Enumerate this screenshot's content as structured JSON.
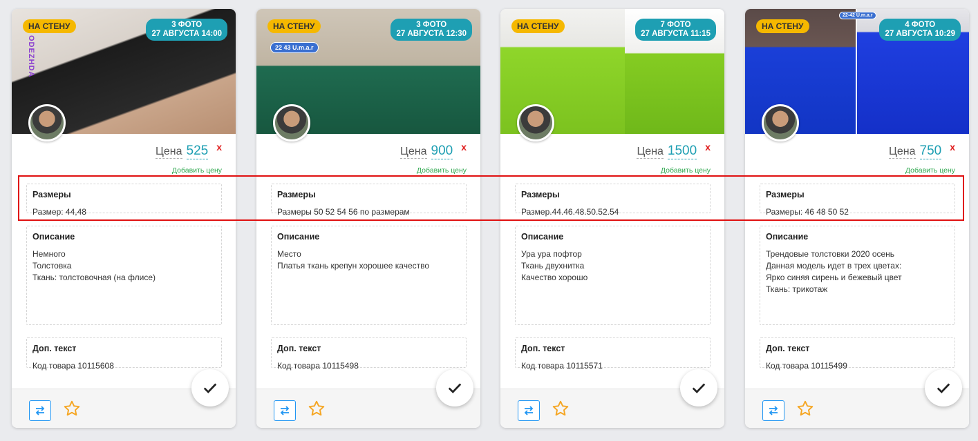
{
  "cards": [
    {
      "wall_badge": "НА СТЕНУ",
      "photo_count": "3 ФОТО",
      "photo_date": "27 АВГУСТА 14:00",
      "watermark": "ODEZHDA",
      "price_label": "Цена",
      "price": "525",
      "remove_price": "x",
      "add_price": "Добавить цену",
      "sizes_title": "Размеры",
      "sizes": "Размер: 44,48",
      "desc_title": "Описание",
      "desc": "Немного\nТолстовка\nТкань: толстовочная (на флисе)",
      "extra_title": "Доп. текст",
      "extra": "Код товара 10115608"
    },
    {
      "wall_badge": "НА СТЕНУ",
      "photo_count": "3 ФОТО",
      "photo_date": "27 АВГУСТА 12:30",
      "watermark": "22 43 U.m.a.r",
      "price_label": "Цена",
      "price": "900",
      "remove_price": "x",
      "add_price": "Добавить цену",
      "sizes_title": "Размеры",
      "sizes": "Размеры 50 52 54 56 по размерам",
      "desc_title": "Описание",
      "desc": "Место\nПлатья ткань крепун хорошее качество",
      "extra_title": "Доп. текст",
      "extra": "Код товара 10115498"
    },
    {
      "wall_badge": "НА СТЕНУ",
      "photo_count": "7 ФОТО",
      "photo_date": "27 АВГУСТА 11:15",
      "watermark": "",
      "price_label": "Цена",
      "price": "1500",
      "remove_price": "x",
      "add_price": "Добавить цену",
      "sizes_title": "Размеры",
      "sizes": "Размер.44.46.48.50.52.54",
      "desc_title": "Описание",
      "desc": "Ура ура пофтор\nТкань двухнитка\nКачество хорошо",
      "extra_title": "Доп. текст",
      "extra": "Код товара 10115571"
    },
    {
      "wall_badge": "НА СТЕНУ",
      "photo_count": "4 ФОТО",
      "photo_date": "27 АВГУСТА 10:29",
      "watermark": "22-42 U.m.a.r",
      "price_label": "Цена",
      "price": "750",
      "remove_price": "x",
      "add_price": "Добавить цену",
      "sizes_title": "Размеры",
      "sizes": "Размеры: 46 48 50 52",
      "desc_title": "Описание",
      "desc": "Трендовые толстовки 2020 осень\nДанная модель идет в трех цветах:\nЯрко синяя сирень и бежевый цвет\nТкань: трикотаж",
      "extra_title": "Доп. текст",
      "extra": "Код товара 10115499"
    }
  ],
  "colors": {
    "accent": "#1e9fb3",
    "wall_badge": "#f5b800",
    "add_price": "#2fa84f",
    "remove": "#e02020",
    "highlight": "#e01010",
    "swap_icon": "#2196f3",
    "star_icon": "#f5a623"
  },
  "icons": [
    "swap-icon",
    "star-icon",
    "check-icon"
  ]
}
